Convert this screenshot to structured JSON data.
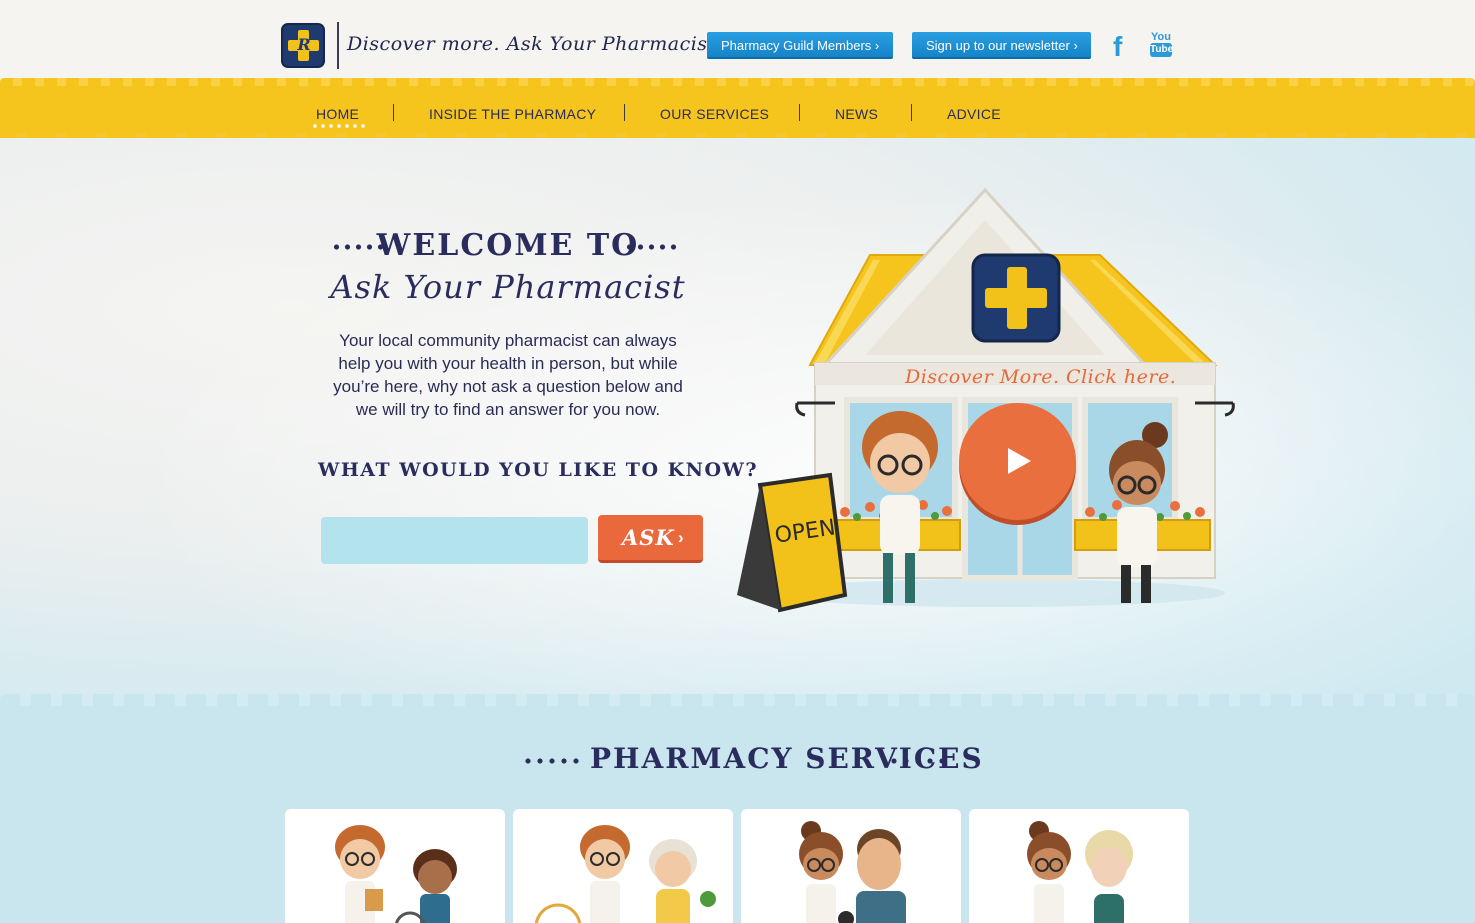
{
  "header": {
    "tagline": "Discover more. Ask Your Pharmacist.",
    "logo_letter": "R",
    "guild_button": "Pharmacy Guild Members",
    "newsletter_button": "Sign up to our newsletter",
    "chevron": "›",
    "social": {
      "facebook": "f",
      "youtube_top": "You",
      "youtube_bottom": "Tube"
    }
  },
  "nav": {
    "items": [
      {
        "label": "HOME",
        "active": true
      },
      {
        "label": "INSIDE THE PHARMACY"
      },
      {
        "label": "OUR SERVICES"
      },
      {
        "label": "NEWS"
      },
      {
        "label": "ADVICE"
      }
    ]
  },
  "hero": {
    "welcome_line": "WELCOME TO",
    "title": "Ask Your Pharmacist",
    "intro": "Your local community pharmacist can always help you with your health in person, but while you’re here, why not ask a question below and we will try to find an answer for you now.",
    "question_heading": "WHAT WOULD YOU LIKE TO KNOW?",
    "ask_input_value": "",
    "ask_button": "ASK",
    "ask_chevron": "›",
    "shop_sign": "Discover More. Click here.",
    "open_sign": "OPEN"
  },
  "services": {
    "title": "PHARMACY SERVICES",
    "cards": [
      "card-1",
      "card-2",
      "card-3",
      "card-4"
    ]
  },
  "colors": {
    "navy": "#2a2c5e",
    "yellow": "#f6c51d",
    "blue_button": "#1a8fd5",
    "orange": "#e96f3f",
    "input": "#b3e3ed"
  }
}
